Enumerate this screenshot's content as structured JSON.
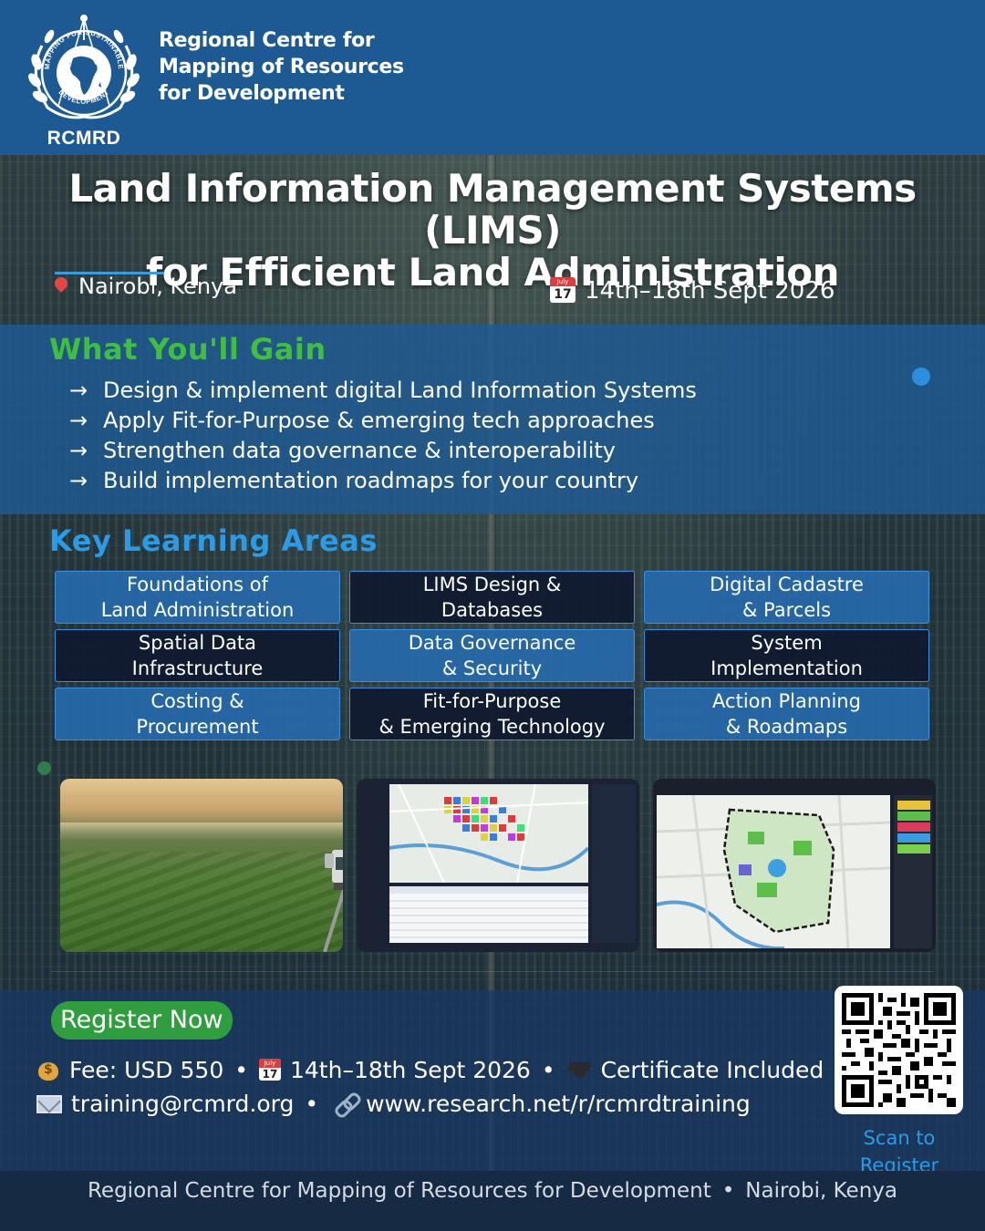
{
  "header": {
    "logo": {
      "ring_text_top": "MAPPING FOR SUSTAINABLE",
      "ring_text_bottom": "DEVELOPMENT",
      "acronym": "RCMRD"
    },
    "org_name_lines": [
      "Regional Centre for",
      "Mapping of Resources",
      "for Development"
    ]
  },
  "title_lines": [
    "Land Information Management Systems (LIMS)",
    "for Efficient Land Administration"
  ],
  "event": {
    "location": "Nairobi, Kenya",
    "dates": "14th–18th Sept 2026"
  },
  "gain": {
    "heading": "What You'll Gain",
    "arrow": "→",
    "items": [
      "Design & implement digital Land Information Systems",
      "Apply Fit-for-Purpose & emerging tech approaches",
      "Strengthen data governance & interoperability",
      "Build implementation roadmaps for your country"
    ]
  },
  "areas": {
    "heading": "Key Learning Areas",
    "cells": [
      "Foundations of\nLand Administration",
      "LIMS Design &\nDatabases",
      "Digital Cadastre\n& Parcels",
      "Spatial Data\nInfrastructure",
      "Data Governance\n& Security",
      "System\nImplementation",
      "Costing &\nProcurement",
      "Fit-for-Purpose\n& Emerging Technology",
      "Action Planning\n& Roadmaps"
    ]
  },
  "register": {
    "button_label": "Register Now",
    "fee": "Fee: USD 550",
    "dates": "14th–18th Sept 2026",
    "certificate": "Certificate Included",
    "email": "training@rcmrd.org",
    "url": "www.research.net/r/rcmrdtraining",
    "bullet": "•",
    "scan_text_lines": [
      "Scan to",
      "Register"
    ]
  },
  "footer": {
    "org": "Regional Centre for Mapping of Resources for Development",
    "bullet": "•",
    "location": "Nairobi, Kenya"
  },
  "colors": {
    "brand_blue": "#1d5a94",
    "gain_green": "#3fbf3f",
    "areas_blue": "#2a9be6",
    "register_green": "#2e9e3e"
  }
}
